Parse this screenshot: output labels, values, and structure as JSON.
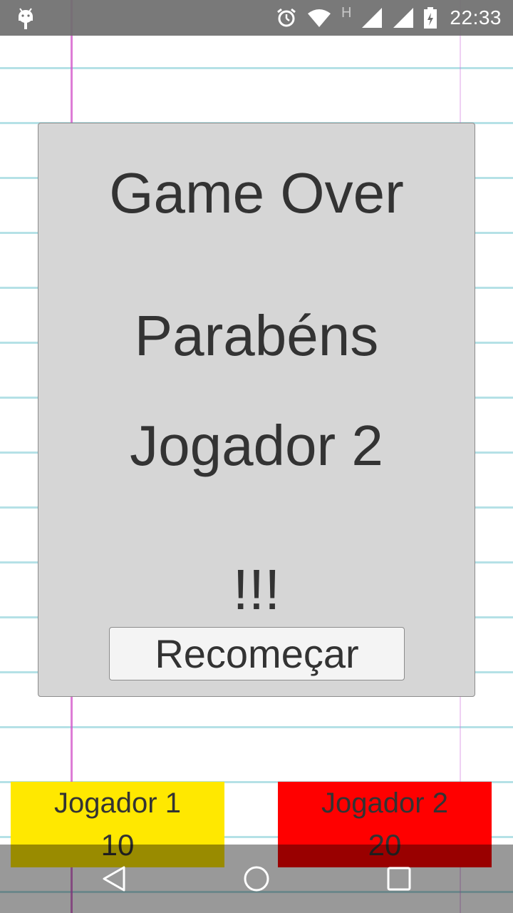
{
  "status_bar": {
    "time": "22:33",
    "network_label": "H",
    "icons": [
      "android-icon",
      "alarm-icon",
      "wifi-icon",
      "signal-icon",
      "signal-icon",
      "battery-icon"
    ]
  },
  "dialog": {
    "title": "Game Over",
    "congrats": "Parabéns",
    "winner": "Jogador 2",
    "exclaim": "!!!",
    "restart_label": "Recomeçar"
  },
  "scores": {
    "player1": {
      "name": "Jogador 1",
      "score": "10",
      "color": "#ffe800"
    },
    "player2": {
      "name": "Jogador 2",
      "score": "20",
      "color": "#ff0000"
    }
  },
  "nav_bar": {
    "icons": [
      "back-icon",
      "home-icon",
      "recents-icon"
    ]
  }
}
